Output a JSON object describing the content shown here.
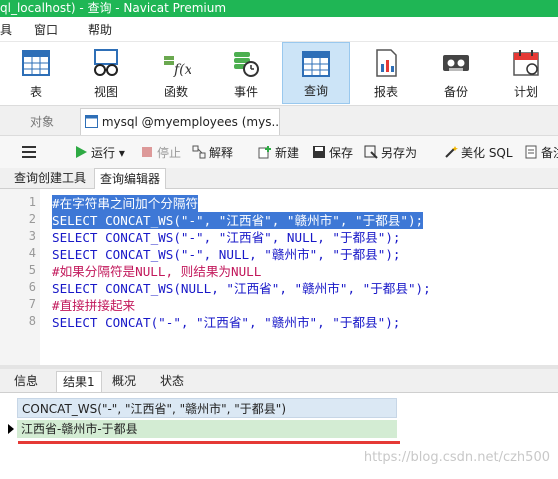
{
  "window": {
    "title": "ql_localhost) - 查询 - Navicat Premium"
  },
  "menu": {
    "items": [
      "具",
      "窗口",
      "帮助"
    ]
  },
  "ribbon": {
    "buttons": [
      "表",
      "视图",
      "函数",
      "事件",
      "查询",
      "报表",
      "备份",
      "计划"
    ],
    "active": "查询"
  },
  "tabs": {
    "objects": "对象",
    "query_tab": "mysql @myemployees (mys..."
  },
  "toolbar": {
    "run": "运行",
    "stop": "停止",
    "explain": "解释",
    "new": "新建",
    "save": "保存",
    "save_as": "另存为",
    "beautify": "美化 SQL",
    "more": "备注"
  },
  "subtabs": {
    "builder": "查询创建工具",
    "editor": "查询编辑器"
  },
  "editor": {
    "line_numbers": [
      "1",
      "2",
      "3",
      "4",
      "5",
      "6",
      "7",
      "8"
    ],
    "lines": [
      "#在字符串之间加个分隔符",
      "SELECT CONCAT_WS(\"-\", \"江西省\", \"赣州市\", \"于都县\");",
      "SELECT CONCAT_WS(\"-\", \"江西省\", NULL, \"于都县\");",
      "SELECT CONCAT_WS(\"-\", NULL, \"赣州市\", \"于都县\");",
      "#如果分隔符是NULL, 则结果为NULL",
      "SELECT CONCAT_WS(NULL, \"江西省\", \"赣州市\", \"于都县\");",
      "#直接拼接起来",
      "SELECT CONCAT(\"-\", \"江西省\", \"赣州市\", \"于都县\");"
    ]
  },
  "result_tabs": {
    "info": "信息",
    "result1": "结果1",
    "overview": "概况",
    "status": "状态"
  },
  "grid": {
    "column_header": "CONCAT_WS(\"-\", \"江西省\", \"赣州市\", \"于都县\")",
    "row_value": "江西省-赣州市-于都县"
  },
  "watermark": "https://blog.csdn.net/czh500",
  "colors": {
    "titlebar": "#1fb655",
    "selection": "#3e78d6",
    "keyword": "#1818c8",
    "string": "#b71c1c",
    "comment": "#c2185b",
    "row": "#d3ecd3"
  }
}
